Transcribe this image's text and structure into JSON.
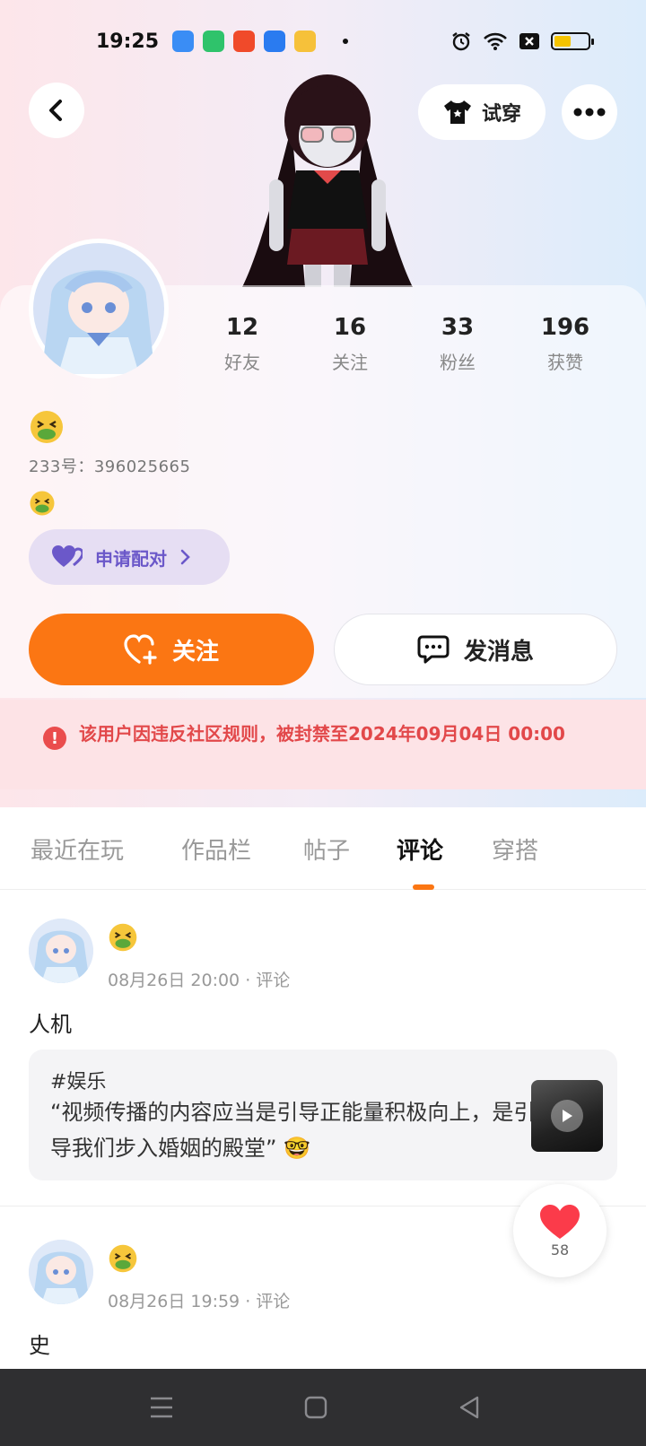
{
  "status_bar": {
    "time": "19:25"
  },
  "header": {
    "tryon_label": "试穿"
  },
  "profile": {
    "stats": [
      {
        "value": "12",
        "label": "好友"
      },
      {
        "value": "16",
        "label": "关注"
      },
      {
        "value": "33",
        "label": "粉丝"
      },
      {
        "value": "196",
        "label": "获赞"
      }
    ],
    "user_id": "233号：396025665",
    "pair_label": "申请配对",
    "follow_label": "关注",
    "message_label": "发消息",
    "ban_notice": "该用户因违反社区规则，被封禁至2024年09月04日 00:00"
  },
  "tabs": [
    {
      "label": "最近在玩",
      "active": false
    },
    {
      "label": "作品栏",
      "active": false
    },
    {
      "label": "帖子",
      "active": false
    },
    {
      "label": "评论",
      "active": true
    },
    {
      "label": "穿搭",
      "active": false
    }
  ],
  "posts": [
    {
      "meta": "08月26日  20:00 · 评论",
      "text": "人机",
      "quote_tag": "#娱乐",
      "quote_text": "“视频传播的内容应当是引导正能量积极向上，是引导我们步入婚姻的殿堂” 🤓"
    },
    {
      "meta": "08月26日  19:59 · 评论",
      "text": "史"
    }
  ],
  "like_fab": {
    "count": "58"
  },
  "colors": {
    "accent": "#fb7613",
    "pair": "#6b58c9",
    "ban": "#e2484a"
  }
}
